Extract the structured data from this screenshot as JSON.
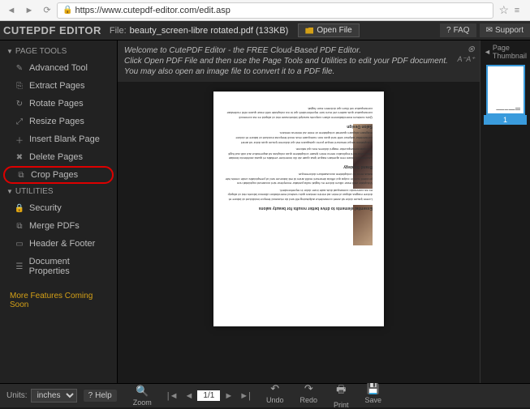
{
  "browser": {
    "url": "https://www.cutepdf-editor.com/edit.asp"
  },
  "header": {
    "brand": "CUTEPDF EDITOR",
    "file_label": "File:",
    "file_name": "beauty_screen-libre rotated.pdf (133KB)",
    "open_file": "Open File",
    "faq": "FAQ",
    "support": "Support"
  },
  "sidebar": {
    "page_tools_label": "PAGE TOOLS",
    "utilities_label": "UTILITIES",
    "page_tools": [
      {
        "label": "Advanced Tool"
      },
      {
        "label": "Extract Pages"
      },
      {
        "label": "Rotate Pages"
      },
      {
        "label": "Resize Pages"
      },
      {
        "label": "Insert Blank Page"
      },
      {
        "label": "Delete Pages"
      },
      {
        "label": "Crop Pages"
      }
    ],
    "utilities": [
      {
        "label": "Security"
      },
      {
        "label": "Merge PDFs"
      },
      {
        "label": "Header & Footer"
      },
      {
        "label": "Document Properties"
      }
    ],
    "more_features": "More Features Coming Soon"
  },
  "welcome": {
    "line1": "Welcome to CutePDF Editor - the FREE Cloud-Based PDF Editor.",
    "line2": "Click Open PDF File and then use the Page Tools and Utilities to edit your PDF document. You may also open an image file to convert it to a PDF file."
  },
  "thumb": {
    "header": "Page Thumbnail",
    "num": "1"
  },
  "bottom": {
    "units_label": "Units:",
    "units_value": "inches",
    "help": "Help",
    "zoom": "Zoom",
    "page_display": "1/1",
    "undo": "Undo",
    "redo": "Redo",
    "print": "Print",
    "save": "Save"
  },
  "highlighted_item_index": 6
}
